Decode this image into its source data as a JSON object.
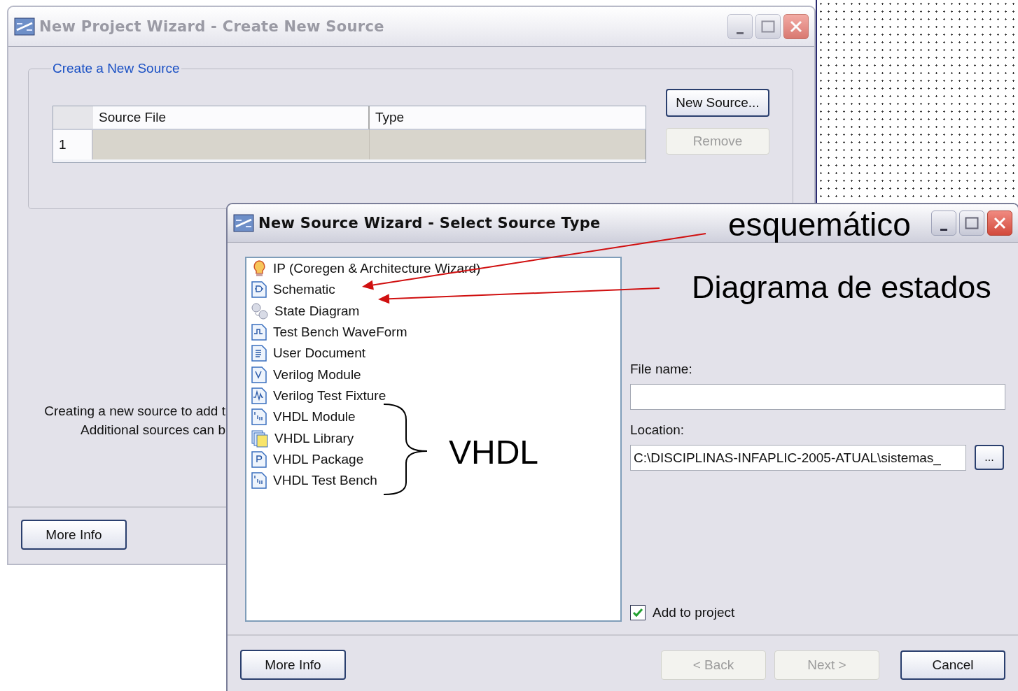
{
  "background_window": {
    "title": "New Project Wizard - Create New Source",
    "active": false,
    "group_title": "Create a New Source",
    "table": {
      "columns": [
        "Source File",
        "Type"
      ],
      "rows": [
        {
          "number": "1"
        }
      ]
    },
    "buttons": [
      {
        "label": "New Source...",
        "disabled": false
      },
      {
        "label": "Remove",
        "disabled": true
      }
    ],
    "info_lines": [
      "Creating a new source to add t",
      "Additional sources can b"
    ],
    "more_info": "More Info"
  },
  "front_window": {
    "title": "New Source Wizard - Select Source Type",
    "active": true,
    "source_types": [
      {
        "label": "IP (Coregen & Architecture Wizard)",
        "kind": "ip"
      },
      {
        "label": "Schematic",
        "kind": "schematic"
      },
      {
        "label": "State Diagram",
        "kind": "state"
      },
      {
        "label": "Test Bench WaveForm",
        "kind": "waveform"
      },
      {
        "label": "User Document",
        "kind": "document"
      },
      {
        "label": "Verilog Module",
        "kind": "verilog"
      },
      {
        "label": "Verilog Test Fixture",
        "kind": "fixture"
      },
      {
        "label": "VHDL Module",
        "kind": "vhdl"
      },
      {
        "label": "VHDL Library",
        "kind": "library"
      },
      {
        "label": "VHDL Package",
        "kind": "package"
      },
      {
        "label": "VHDL Test Bench",
        "kind": "vhdl"
      }
    ],
    "file_name": {
      "label": "File name:"
    },
    "location": {
      "label": "Location:",
      "value": "C:\\DISCIPLINAS-INFAPLIC-2005-ATUAL\\sistemas_",
      "browse": "..."
    },
    "add_to_project": {
      "label": "Add to project",
      "checked": true
    },
    "more_info": "More Info",
    "nav_buttons": [
      {
        "label": "< Back",
        "disabled": true
      },
      {
        "label": "Next >",
        "disabled": true
      },
      {
        "label": "Cancel",
        "disabled": false
      }
    ]
  },
  "annotations": [
    {
      "text": "esquemático"
    },
    {
      "text": "Diagrama de estados"
    },
    {
      "text": "VHDL"
    }
  ]
}
